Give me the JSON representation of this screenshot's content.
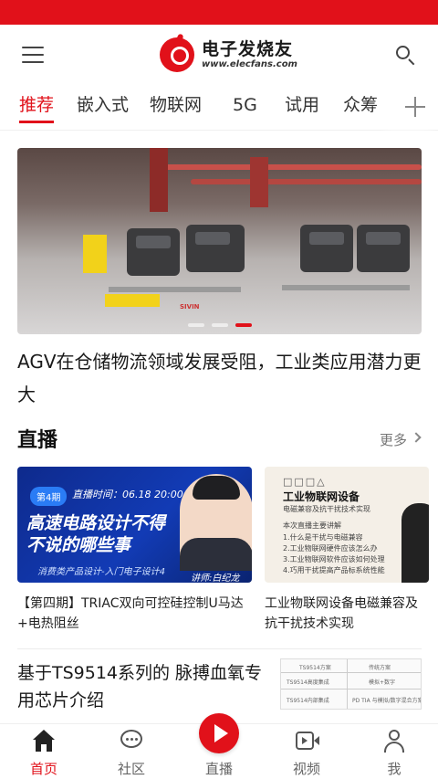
{
  "brand": {
    "name_cn": "电子发烧友",
    "url": "www.elecfans.com",
    "accent_color": "#e1111a"
  },
  "icons": {
    "menu": "hamburger-menu-icon",
    "search": "search-icon",
    "add_channel": "plus-icon"
  },
  "tabs": [
    {
      "label": "推荐",
      "active": true
    },
    {
      "label": "嵌入式",
      "active": false
    },
    {
      "label": "物联网",
      "active": false
    },
    {
      "label": "5G",
      "active": false
    },
    {
      "label": "试用",
      "active": false
    },
    {
      "label": "众筹",
      "active": false
    }
  ],
  "banner": {
    "sign_text": "SIVIN",
    "slides_count": 3,
    "active_slide": 3
  },
  "headline": "AGV在仓储物流领域发展受阻，工业类应用潜力更大",
  "live_section": {
    "title": "直播",
    "more_label": "更多",
    "cards": [
      {
        "badge": "第4期",
        "time_text": "直播时间：06.18 20:00",
        "big_title_1": "高速电路设计不得",
        "big_title_2": "不说的哪些事",
        "subtitle": "消费类产品设计-入门电子设计4",
        "lecturer": "讲师:白纪龙",
        "caption": "【第四期】TRIAC双向可控硅控制U马达+电热阻丝"
      },
      {
        "boxes": "□□□△",
        "thumb_title": "工业物联网设备",
        "thumb_lines": [
          "电磁兼容及抗干扰技术实现",
          "本次直播主要讲解",
          "1.什么是干扰与电磁兼容",
          "2.工业物联网硬件应该怎么办",
          "3.工业物联网软件应该如何处理",
          "4.巧用干扰提高产品标系统性能"
        ],
        "caption": "工业物联网设备电磁兼容及抗干扰技术实现"
      }
    ]
  },
  "article": {
    "title": "基于TS9514系列的 脉搏血氧专用芯片介绍",
    "thumb_cells": [
      "TS9514方案",
      "传统方案",
      "TS9514高度集成",
      "模拟+数字",
      "TS9514内部集成",
      "PD TIA 与模拟/数字混合方案"
    ]
  },
  "bottom_nav": [
    {
      "label": "首页",
      "icon": "home-icon",
      "active": true
    },
    {
      "label": "社区",
      "icon": "chat-bubble-icon",
      "active": false
    },
    {
      "label": "直播",
      "icon": "play-icon",
      "active": false
    },
    {
      "label": "视频",
      "icon": "video-camera-icon",
      "active": false
    },
    {
      "label": "我",
      "icon": "user-icon",
      "active": false
    }
  ]
}
